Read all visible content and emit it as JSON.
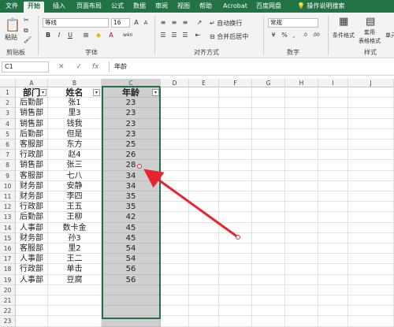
{
  "ribbon_tabs": [
    "文件",
    "开始",
    "插入",
    "页面布局",
    "公式",
    "数据",
    "审阅",
    "视图",
    "帮助",
    "Acrobat",
    "百度网盘",
    "操作说明搜索"
  ],
  "ribbon": {
    "paste_label": "粘贴",
    "clipboard_label": "剪贴板",
    "font_label": "字体",
    "font_name": "等线",
    "font_size": "16",
    "bold": "B",
    "italic": "I",
    "underline": "U",
    "font_a": "A",
    "wen": "wén",
    "align_label": "对齐方式",
    "wrap_text": "自动换行",
    "merge_center": "合并后居中",
    "number_label": "数字",
    "number_format": "常规",
    "percent": "%",
    "comma": ",",
    "conditional_format": "条件格式",
    "table_format_1": "套用",
    "table_format_2": "表格格式",
    "cell_style": "单元",
    "styles_label": "样式"
  },
  "formula_bar": {
    "name_box": "C1",
    "cancel": "✕",
    "confirm": "✓",
    "fx": "fx",
    "content": "年龄"
  },
  "columns": [
    "A",
    "B",
    "C",
    "D",
    "E",
    "F",
    "G",
    "H",
    "I",
    "J"
  ],
  "selected_column": "C",
  "headers": [
    "部门",
    "姓名",
    "年龄"
  ],
  "rows": [
    [
      "后勤部",
      "张1",
      "23"
    ],
    [
      "销售部",
      "里3",
      "23"
    ],
    [
      "销售部",
      "钱我",
      "23"
    ],
    [
      "后勤部",
      "但是",
      "23"
    ],
    [
      "客服部",
      "东方",
      "25"
    ],
    [
      "行政部",
      "赵4",
      "26"
    ],
    [
      "销售部",
      "张三",
      "28"
    ],
    [
      "客服部",
      "七八",
      "34"
    ],
    [
      "财务部",
      "安静",
      "34"
    ],
    [
      "财务部",
      "李四",
      "35"
    ],
    [
      "行政部",
      "王五",
      "35"
    ],
    [
      "后勤部",
      "王柳",
      "42"
    ],
    [
      "人事部",
      "数卡金",
      "45"
    ],
    [
      "财务部",
      "孙3",
      "45"
    ],
    [
      "客服部",
      "里2",
      "54"
    ],
    [
      "人事部",
      "王二",
      "54"
    ],
    [
      "行政部",
      "单击",
      "56"
    ],
    [
      "人事部",
      "豆腐",
      "56"
    ]
  ],
  "row_numbers": [
    "1",
    "2",
    "3",
    "4",
    "5",
    "6",
    "7",
    "8",
    "9",
    "10",
    "11",
    "12",
    "13",
    "14",
    "15",
    "16",
    "17",
    "18",
    "19",
    "20",
    "21",
    "22",
    "23"
  ],
  "annotation": {
    "color": "#e8242f",
    "target_value": "28",
    "arrow": "red annotation arrow pointing to cell C8"
  },
  "colors": {
    "excel_green": "#217346",
    "selection_fill": "#cfcfcf"
  }
}
